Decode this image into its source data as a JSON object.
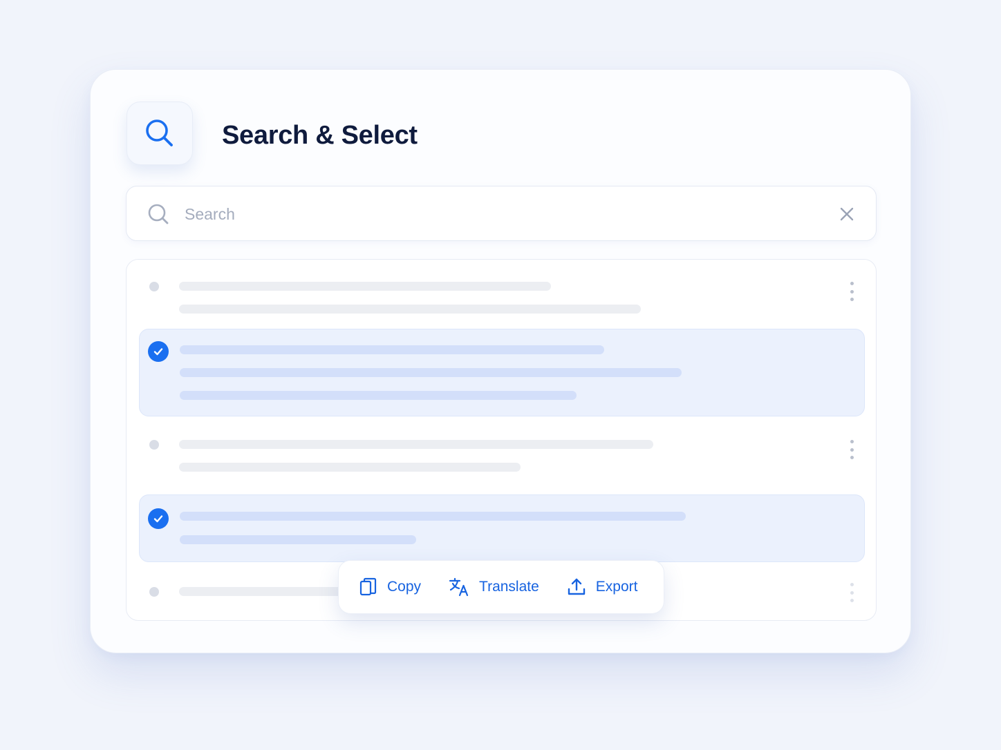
{
  "header": {
    "title": "Search & Select",
    "logo_icon": "search-icon"
  },
  "search": {
    "placeholder": "Search",
    "value": "",
    "clear_icon": "close-icon"
  },
  "results": {
    "items": [
      {
        "selected": false,
        "has_menu": true
      },
      {
        "selected": true,
        "has_menu": false
      },
      {
        "selected": false,
        "has_menu": true
      },
      {
        "selected": true,
        "has_menu": false
      },
      {
        "selected": false,
        "has_menu": true
      }
    ]
  },
  "actions": {
    "copy_label": "Copy",
    "translate_label": "Translate",
    "export_label": "Export"
  },
  "colors": {
    "accent": "#1a6ff0",
    "title": "#0f1b3d",
    "selected_row": "#ebf1fd",
    "background": "#f1f4fb"
  }
}
